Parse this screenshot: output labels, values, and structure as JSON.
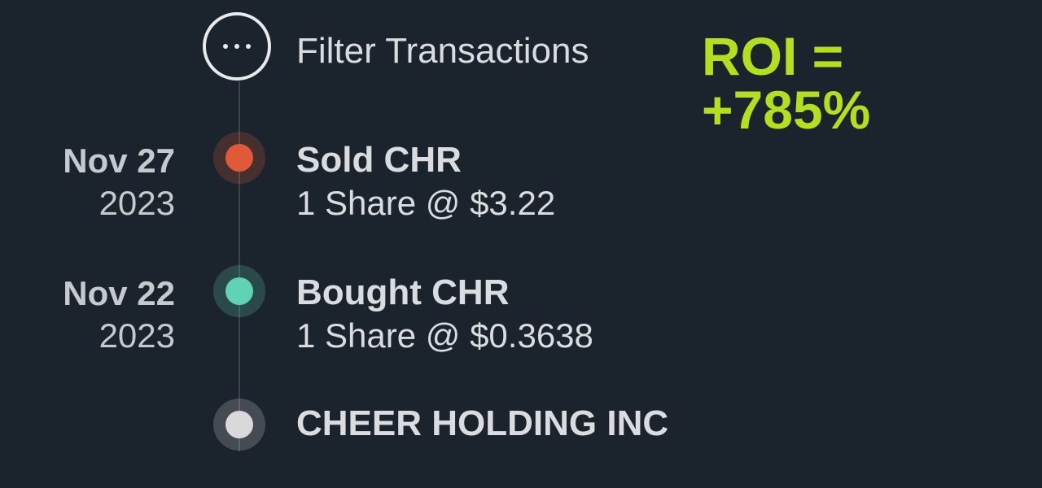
{
  "filter": {
    "label": "Filter Transactions",
    "icon": "more-horizontal-icon"
  },
  "roi": {
    "line1": "ROI =",
    "line2": "+785%",
    "color": "#b3e01e"
  },
  "transactions": [
    {
      "month_day": "Nov 27",
      "year": "2023",
      "title": "Sold CHR",
      "detail": "1 Share @ $3.22",
      "status_color": "#e05a3a"
    },
    {
      "month_day": "Nov 22",
      "year": "2023",
      "title": "Bought CHR",
      "detail": "1 Share @ $0.3638",
      "status_color": "#5fd3b3"
    }
  ],
  "company": {
    "name": "CHEER HOLDING INC",
    "status_color": "#d9d9dc"
  }
}
